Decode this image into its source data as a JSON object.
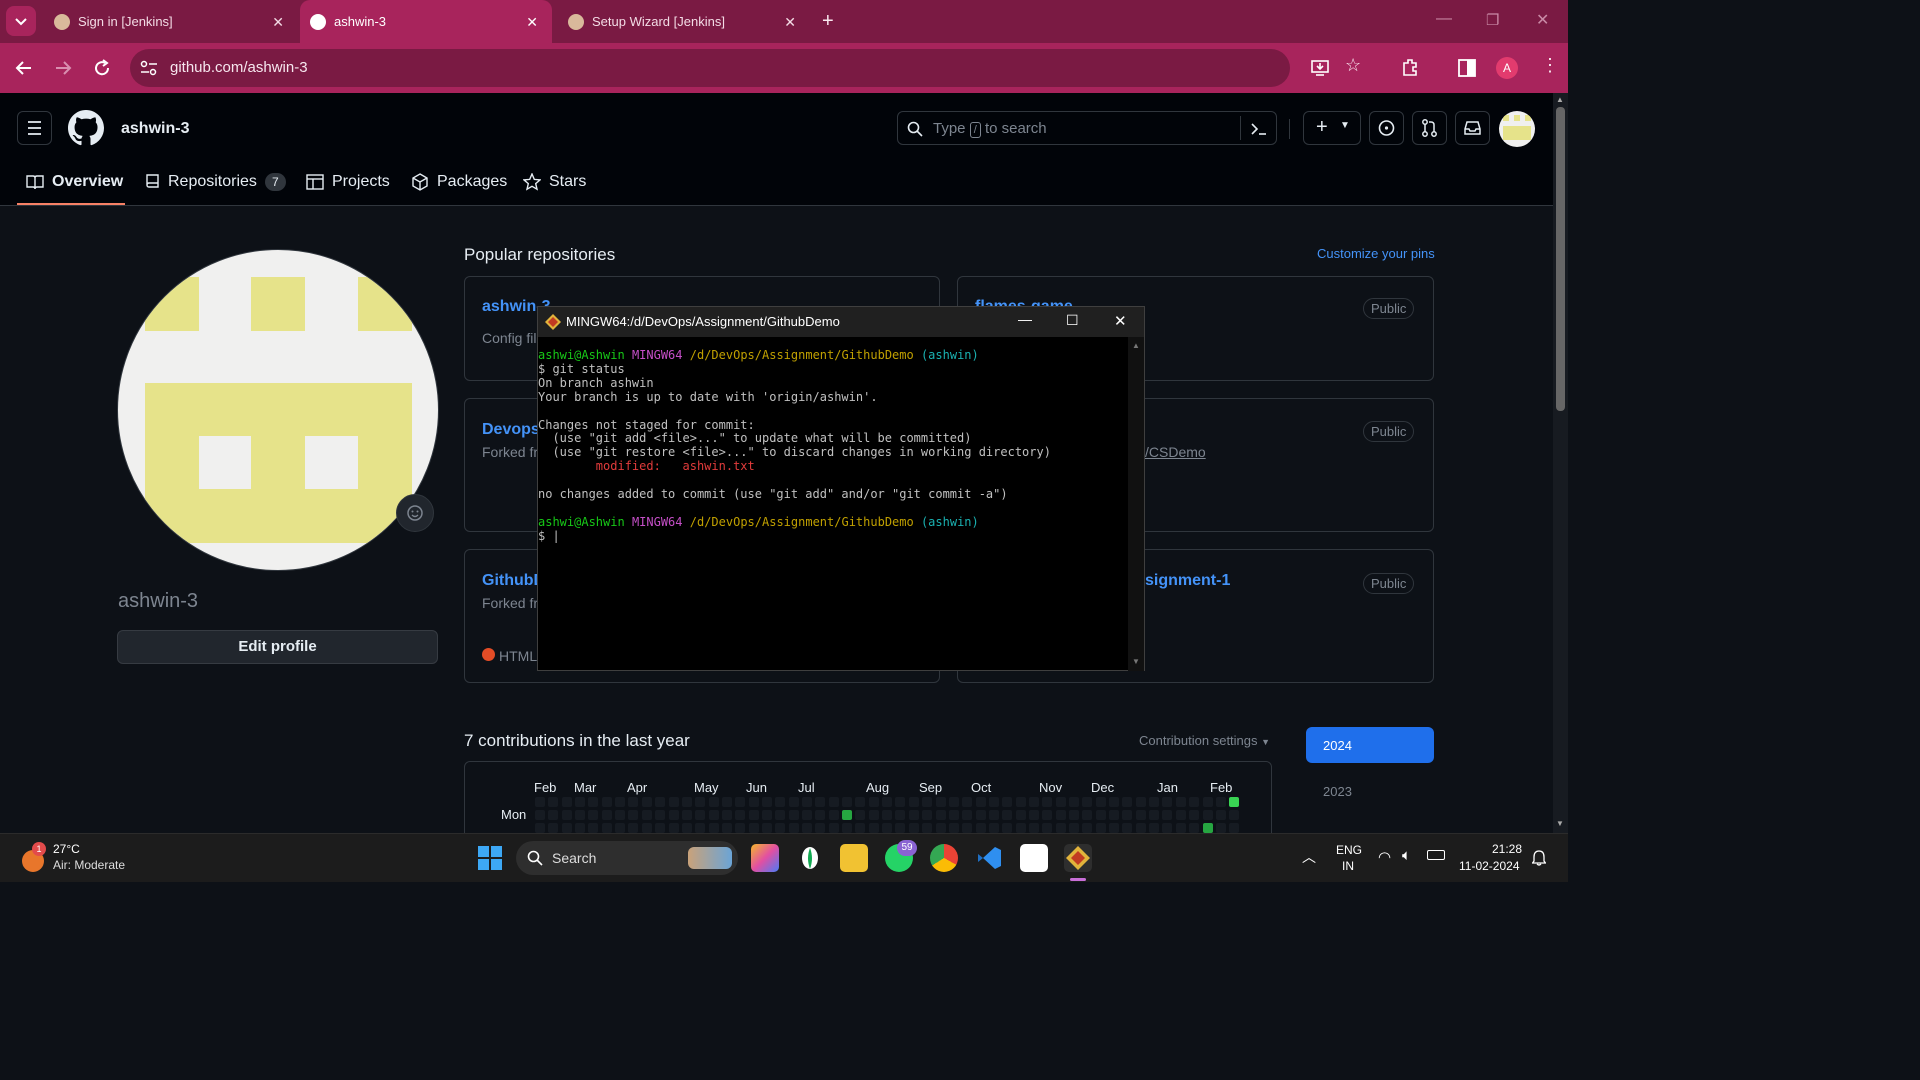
{
  "browser": {
    "tabs": [
      {
        "title": "Sign in [Jenkins]",
        "active": false
      },
      {
        "title": "ashwin-3",
        "active": true
      },
      {
        "title": "Setup Wizard [Jenkins]",
        "active": false
      }
    ],
    "url": "github.com/ashwin-3",
    "profile_initial": "A"
  },
  "github": {
    "username": "ashwin-3",
    "search_placeholder": "Type / to search",
    "search_placeholder_prefix": "Type",
    "search_placeholder_key": "/",
    "search_placeholder_suffix": "to search",
    "nav": {
      "overview": "Overview",
      "repositories": "Repositories",
      "repositories_count": "7",
      "projects": "Projects",
      "packages": "Packages",
      "stars": "Stars"
    },
    "profile_name": "ashwin-3",
    "edit_profile": "Edit profile",
    "popular_title": "Popular repositories",
    "customize_pins": "Customize your pins",
    "repos": [
      {
        "name": "ashwin-3",
        "desc": "Config file",
        "badge": "Public"
      },
      {
        "name": "flames-game",
        "desc": "",
        "badge": "Public"
      },
      {
        "name": "Devops",
        "desc": "Forked fro",
        "badge": "Public"
      },
      {
        "name": "",
        "desc": "/CSDemo",
        "badge": "Public"
      },
      {
        "name": "GithubD",
        "desc": "Forked fro",
        "lang": "HTML",
        "badge": ""
      },
      {
        "name": "signment-1",
        "desc": "",
        "badge": "Public"
      }
    ],
    "contributions_title": "7 contributions in the last year",
    "contribution_settings": "Contribution settings",
    "months": [
      "Feb",
      "Mar",
      "Apr",
      "May",
      "Jun",
      "Jul",
      "Aug",
      "Sep",
      "Oct",
      "Nov",
      "Dec",
      "Jan",
      "Feb"
    ],
    "day_label": "Mon",
    "years": [
      "2024",
      "2023"
    ]
  },
  "terminal": {
    "title": "MINGW64:/d/DevOps/Assignment/GithubDemo",
    "prompt_user": "ashwi@Ashwin",
    "prompt_shell": "MINGW64",
    "prompt_path": "/d/DevOps/Assignment/GithubDemo",
    "prompt_branch": "(ashwin)",
    "command": "$ git status",
    "lines": [
      "On branch ashwin",
      "Your branch is up to date with 'origin/ashwin'.",
      "",
      "Changes not staged for commit:",
      "  (use \"git add <file>...\" to update what will be committed)",
      "  (use \"git restore <file>...\" to discard changes in working directory)"
    ],
    "modified_label": "        modified:   ashwin.txt",
    "no_changes": "no changes added to commit (use \"git add\" and/or \"git commit -a\")",
    "cursor_line": "$ |"
  },
  "taskbar": {
    "temp": "27°C",
    "air": "Air: Moderate",
    "weather_badge": "1",
    "search": "Search",
    "whatsapp_badge": "59",
    "lang1": "ENG",
    "lang2": "IN",
    "time": "21:28",
    "date": "11-02-2024"
  }
}
